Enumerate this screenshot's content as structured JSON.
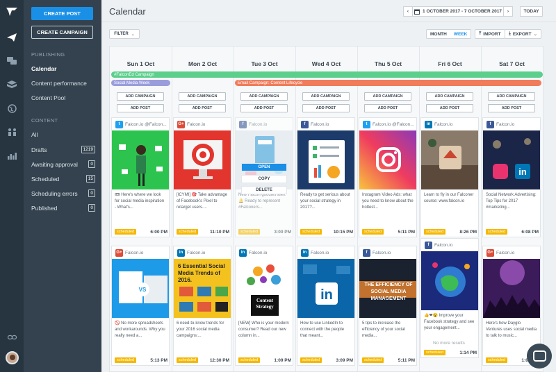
{
  "sidebar": {
    "create_post": "CREATE POST",
    "create_campaign": "CREATE CAMPAIGN",
    "publishing_head": "PUBLISHING",
    "calendar": "Calendar",
    "content_performance": "Content performance",
    "content_pool": "Content Pool",
    "content_head": "CONTENT",
    "items": [
      {
        "label": "All",
        "count": ""
      },
      {
        "label": "Drafts",
        "count": "1219"
      },
      {
        "label": "Awaiting approval",
        "count": "0"
      },
      {
        "label": "Scheduled",
        "count": "15"
      },
      {
        "label": "Scheduling errors",
        "count": "0"
      },
      {
        "label": "Published",
        "count": "0"
      }
    ]
  },
  "header": {
    "title": "Calendar",
    "prev": "‹",
    "range": "1 OCTOBER 2017 - 7 OCTOBER 2017",
    "next": "›",
    "today": "TODAY"
  },
  "toolbar": {
    "filter": "FILTER",
    "month": "MONTH",
    "week": "WEEK",
    "import": "IMPORT",
    "export": "EXPORT"
  },
  "days": [
    "Sun 1 Oct",
    "Mon 2 Oct",
    "Tue 3 Oct",
    "Wed 4 Oct",
    "Thu 5 Oct",
    "Fri 6 Oct",
    "Sat 7 Oct"
  ],
  "campaigns": [
    {
      "label": "#FalconEd Campaign",
      "color": "#5bcf8b"
    },
    {
      "label": "Social Media Week",
      "color": "#9a9ddc"
    },
    {
      "label": "Email Campaign: Content Lifecycle",
      "color": "#f07c5c"
    }
  ],
  "slot_buttons": {
    "add_campaign": "ADD CAMPAIGN",
    "add_post": "ADD POST"
  },
  "post_menu": {
    "open": "OPEN",
    "copy": "COPY",
    "delete": "DELETE"
  },
  "more_results": "No more results",
  "status_label": "scheduled",
  "row1": [
    {
      "net": "tw",
      "icon": "twitter-icon",
      "account": "Falcon.io @Falcon...",
      "text": "🎟 Here's where we look for social media inspiration - What's...",
      "time": "6:00 PM"
    },
    {
      "net": "gp",
      "icon": "google-plus-icon",
      "account": "Falcon.io",
      "text": "[ICYMI] 🎯 Take advantage of Facebook's Pixel to retarget users....",
      "time": "11:10 PM"
    },
    {
      "net": "fb",
      "icon": "facebook-icon",
      "account": "Falcon.io",
      "text": "New Falcon goodies alert 🔔 Ready to represent #Falconers...",
      "time": "3:00 PM"
    },
    {
      "net": "fb",
      "icon": "facebook-icon",
      "account": "Falcon.io",
      "text": "Ready to get serious about your social strategy in 2017?...",
      "time": "10:15 PM"
    },
    {
      "net": "tw",
      "icon": "twitter-icon",
      "account": "Falcon.io @Falcon...",
      "text": "Instagram Video Ads: what you need to know about the hottest...",
      "time": "5:11 PM"
    },
    {
      "net": "li",
      "icon": "linkedin-icon",
      "account": "Falcon.io",
      "text": "Learn to fly in our Falconer course: www.falcon.io",
      "time": "8:26 PM"
    },
    {
      "net": "fb",
      "icon": "facebook-icon",
      "account": "Falcon.io",
      "text": "Social Network Advertising: Top Tips for 2017 #marketing...",
      "time": "6:08 PM"
    }
  ],
  "row2": [
    {
      "net": "gp",
      "icon": "google-plus-icon",
      "account": "Falcon.io",
      "text": "🚫 No more spreadsheets and workarounds. Why you really need a...",
      "time": "5:13 PM"
    },
    {
      "net": "li",
      "icon": "linkedin-icon",
      "account": "Falcon.io",
      "text": "6 need-to-know trends for your 2016 social media campaigns:...",
      "time": "12:30 PM"
    },
    {
      "net": "li",
      "icon": "linkedin-icon",
      "account": "Falcon.io",
      "text": "[NEW] Who is your modern consumer? Read our new column in...",
      "time": "1:09 PM"
    },
    {
      "net": "li",
      "icon": "linkedin-icon",
      "account": "Falcon.io",
      "text": "How to use LinkedIn to connect with the people that meant...",
      "time": "3:09 PM"
    },
    {
      "net": "fb",
      "icon": "facebook-icon",
      "account": "Falcon.io",
      "text": "5 tips to increase the efficiency of your social media...",
      "time": "5:11 PM"
    },
    {
      "net": "fb",
      "icon": "facebook-icon",
      "account": "Falcon.io",
      "text": "👍❤😮 Improve your Facebook strategy and see your engagement...",
      "time": "1:14 PM"
    },
    {
      "net": "gp",
      "icon": "google-plus-icon",
      "account": "Falcon.io",
      "text": "Here's how Dayglo Ventures uses social media to talk to music...",
      "time": "1:03 PM"
    }
  ],
  "image_text": {
    "trends_title": "6 Essential Social Media Trends of 2016.",
    "strategy": "Content Strategy",
    "efficiency": "THE EFFICIENCY OF SOCIAL MEDIA MANAGEMENT",
    "vs": "VS"
  }
}
